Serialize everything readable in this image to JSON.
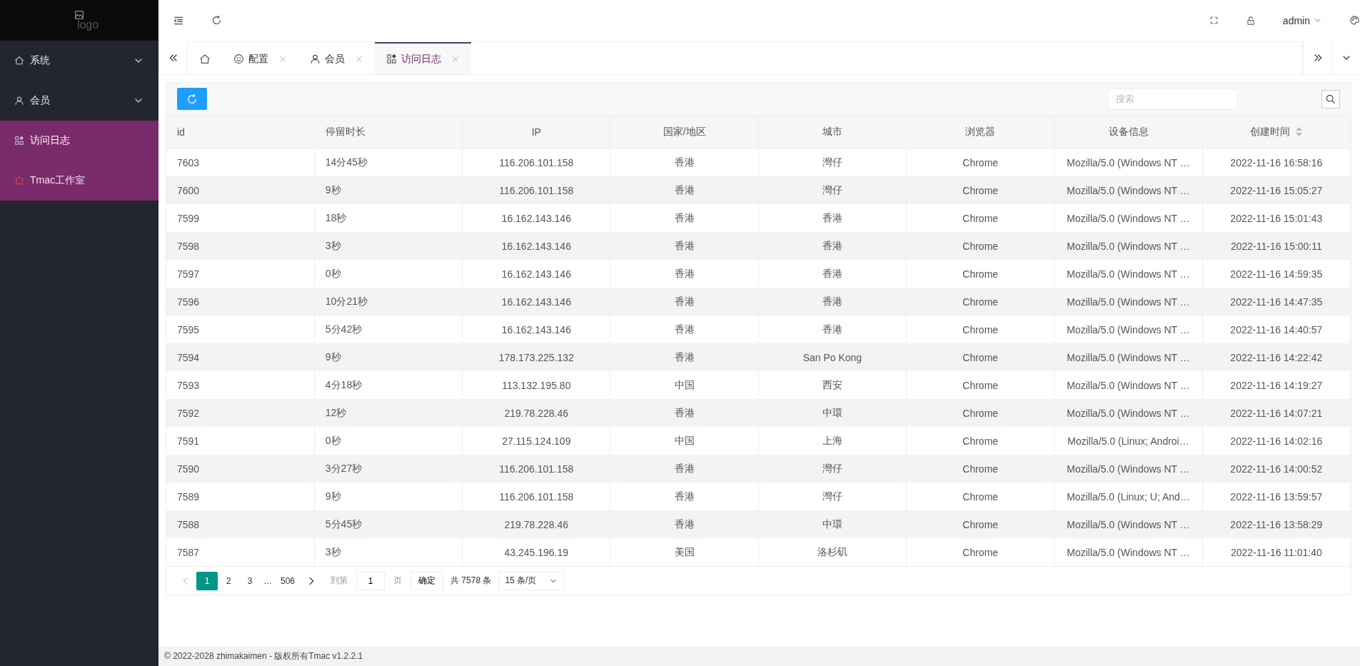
{
  "logo": {
    "alt": "logo"
  },
  "sidebar": {
    "items": [
      {
        "label": "系统",
        "kind": "group",
        "expanded": false
      },
      {
        "label": "会员",
        "kind": "group",
        "expanded": false
      },
      {
        "label": "访问日志",
        "kind": "link",
        "selected": true
      },
      {
        "label": "Tmac工作室",
        "kind": "link",
        "selected": false
      }
    ]
  },
  "header": {
    "user": "admin"
  },
  "tabs": [
    {
      "selected": false,
      "closable": false
    },
    {
      "label": "配置",
      "selected": false,
      "closable": true
    },
    {
      "label": "会员",
      "selected": false,
      "closable": true
    },
    {
      "label": "访问日志",
      "selected": true,
      "closable": true
    }
  ],
  "search": {
    "placeholder": "搜索"
  },
  "table": {
    "columns": [
      {
        "label": "id",
        "sortable": false
      },
      {
        "label": "停留时长",
        "sortable": false
      },
      {
        "label": "IP",
        "sortable": false
      },
      {
        "label": "国家/地区",
        "sortable": false
      },
      {
        "label": "城市",
        "sortable": false
      },
      {
        "label": "浏览器",
        "sortable": false
      },
      {
        "label": "设备信息",
        "sortable": false
      },
      {
        "label": "创建时间",
        "sortable": true
      }
    ],
    "rows": [
      [
        "7603",
        "14分45秒",
        "116.206.101.158",
        "香港",
        "灣仔",
        "Chrome",
        "Mozilla/5.0 (Windows NT …",
        "2022-11-16 16:58:16"
      ],
      [
        "7600",
        "9秒",
        "116.206.101.158",
        "香港",
        "灣仔",
        "Chrome",
        "Mozilla/5.0 (Windows NT …",
        "2022-11-16 15:05:27"
      ],
      [
        "7599",
        "18秒",
        "16.162.143.146",
        "香港",
        "香港",
        "Chrome",
        "Mozilla/5.0 (Windows NT …",
        "2022-11-16 15:01:43"
      ],
      [
        "7598",
        "3秒",
        "16.162.143.146",
        "香港",
        "香港",
        "Chrome",
        "Mozilla/5.0 (Windows NT …",
        "2022-11-16 15:00:11"
      ],
      [
        "7597",
        "0秒",
        "16.162.143.146",
        "香港",
        "香港",
        "Chrome",
        "Mozilla/5.0 (Windows NT …",
        "2022-11-16 14:59:35"
      ],
      [
        "7596",
        "10分21秒",
        "16.162.143.146",
        "香港",
        "香港",
        "Chrome",
        "Mozilla/5.0 (Windows NT …",
        "2022-11-16 14:47:35"
      ],
      [
        "7595",
        "5分42秒",
        "16.162.143.146",
        "香港",
        "香港",
        "Chrome",
        "Mozilla/5.0 (Windows NT …",
        "2022-11-16 14:40:57"
      ],
      [
        "7594",
        "9秒",
        "178.173.225.132",
        "香港",
        "San Po Kong",
        "Chrome",
        "Mozilla/5.0 (Windows NT …",
        "2022-11-16 14:22:42"
      ],
      [
        "7593",
        "4分18秒",
        "113.132.195.80",
        "中国",
        "西安",
        "Chrome",
        "Mozilla/5.0 (Windows NT …",
        "2022-11-16 14:19:27"
      ],
      [
        "7592",
        "12秒",
        "219.78.228.46",
        "香港",
        "中環",
        "Chrome",
        "Mozilla/5.0 (Windows NT …",
        "2022-11-16 14:07:21"
      ],
      [
        "7591",
        "0秒",
        "27.115.124.109",
        "中国",
        "上海",
        "Chrome",
        "Mozilla/5.0 (Linux; Androi…",
        "2022-11-16 14:02:16"
      ],
      [
        "7590",
        "3分27秒",
        "116.206.101.158",
        "香港",
        "灣仔",
        "Chrome",
        "Mozilla/5.0 (Windows NT …",
        "2022-11-16 14:00:52"
      ],
      [
        "7589",
        "9秒",
        "116.206.101.158",
        "香港",
        "灣仔",
        "Chrome",
        "Mozilla/5.0 (Linux; U; And…",
        "2022-11-16 13:59:57"
      ],
      [
        "7588",
        "5分45秒",
        "219.78.228.46",
        "香港",
        "中環",
        "Chrome",
        "Mozilla/5.0 (Windows NT …",
        "2022-11-16 13:58:29"
      ],
      [
        "7587",
        "3秒",
        "43.245.196.19",
        "美国",
        "洛杉矶",
        "Chrome",
        "Mozilla/5.0 (Windows NT …",
        "2022-11-16 11:01:40"
      ]
    ]
  },
  "pagination": {
    "pages": [
      {
        "label": "1",
        "selected": true
      },
      {
        "label": "2",
        "selected": false
      },
      {
        "label": "3",
        "selected": false
      },
      {
        "label": "…",
        "kind": "ellipsis"
      },
      {
        "label": "506",
        "selected": false
      }
    ],
    "prev_disabled": true,
    "goto_label": "到第",
    "goto_value": "1",
    "page_unit": "页",
    "confirm": "确定",
    "total": "共 7578 条",
    "page_size": "15 条/页"
  },
  "footer": "© 2022-2028 zhimakaimen - 版权所有Tmac v1.2.2.1"
}
